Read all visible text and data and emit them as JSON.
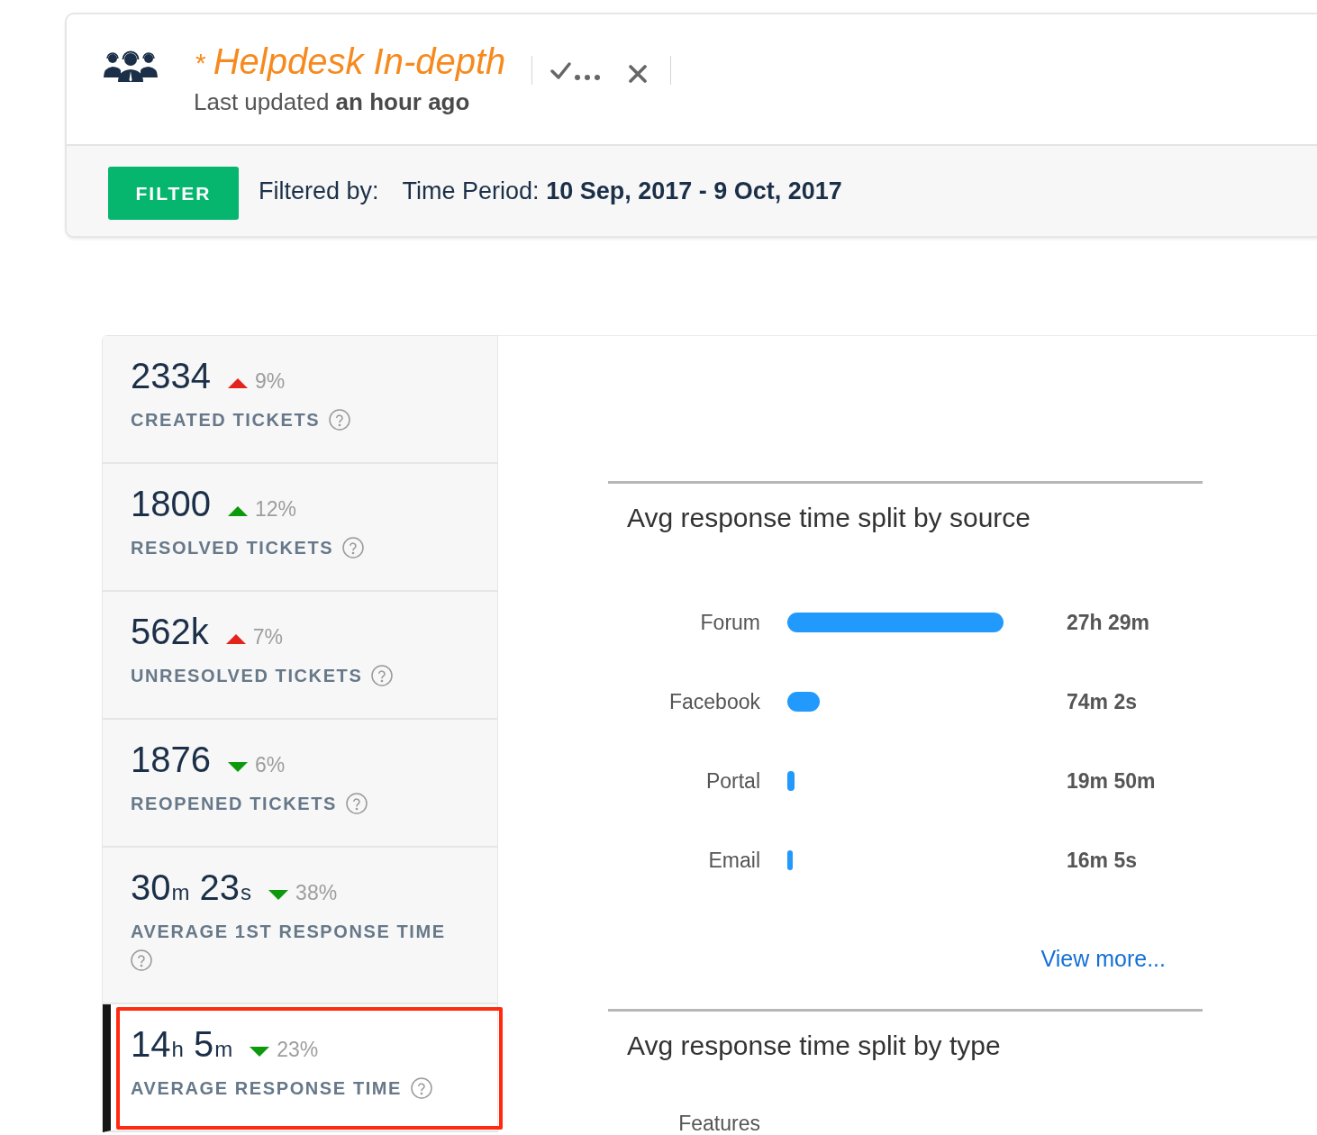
{
  "header": {
    "modified_marker": "*",
    "title": "Helpdesk In-depth",
    "subtitle": "Last updated **an hour ago**"
  },
  "filter_bar": {
    "button": "FILTER",
    "filtered_by": "Filtered by:",
    "filters": [
      {
        "text": "Time Period: **10 Sep, 2017 - 9 Oct, 2017**"
      }
    ]
  },
  "metrics": [
    {
      "value": "2334",
      "increase": true,
      "color": "#e3241d",
      "change": "9%",
      "label": "CREATED TICKETS",
      "selected": false,
      "highlighted": false
    },
    {
      "value": "1800",
      "increase": true,
      "color": "#0c9a0c",
      "change": "12%",
      "label": "RESOLVED TICKETS",
      "selected": false,
      "highlighted": false
    },
    {
      "value": "562k",
      "increase": true,
      "color": "#e3241d",
      "change": "7%",
      "label": "UNRESOLVED TICKETS",
      "selected": false,
      "highlighted": false
    },
    {
      "value": "1876",
      "increase": false,
      "color": "#0c9a0c",
      "change": "6%",
      "label": "REOPENED TICKETS",
      "selected": false,
      "highlighted": false
    },
    {
      "value": "30$_{m}$ 23$_{s}$",
      "increase": false,
      "color": "#0c9a0c",
      "change": "38%",
      "label": "AVERAGE 1ST RESPONSE TIME",
      "selected": false,
      "highlighted": false
    },
    {
      "value": "14$_{h}$ 5$_{m}$",
      "increase": false,
      "color": "#0c9a0c",
      "change": "23%",
      "label": "AVERAGE RESPONSE TIME",
      "selected": true,
      "highlighted": true
    }
  ],
  "panels": [
    {
      "title": "Avg response time split by source",
      "rows": [
        {
          "label": "Forum",
          "reading": "27h 29m"
        },
        {
          "label": "Facebook",
          "reading": "74m 2s"
        },
        {
          "label": "Portal",
          "reading": "19m 50m"
        },
        {
          "label": "Email",
          "reading": "16m 5s"
        }
      ],
      "link": "View more..."
    },
    {
      "title": "Avg response time split by type",
      "rows": [
        {
          "label": "Features"
        }
      ]
    }
  ]
}
